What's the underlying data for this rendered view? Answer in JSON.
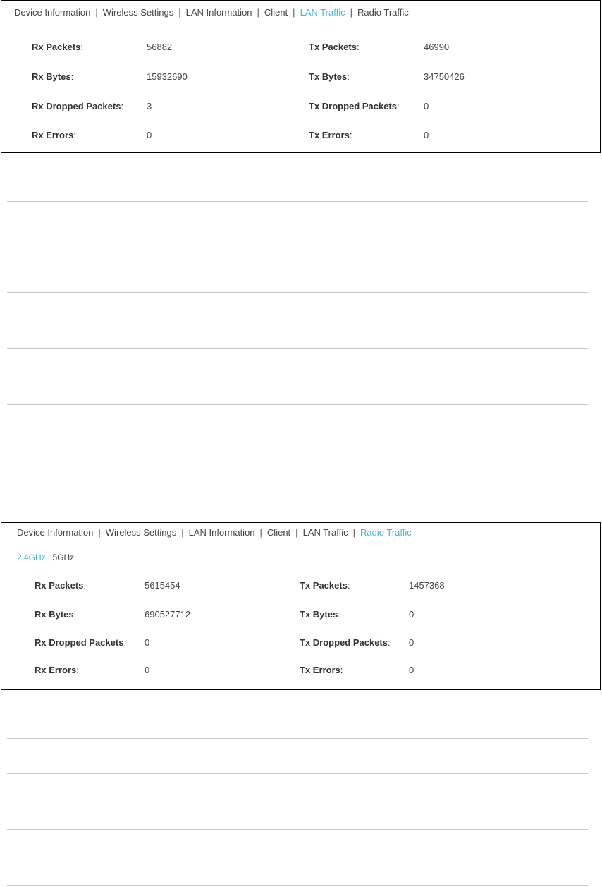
{
  "lan_traffic_panel": {
    "tabs": [
      "Device Information",
      "Wireless Settings",
      "LAN Information",
      "Client",
      "LAN Traffic",
      "Radio Traffic"
    ],
    "active_tab": "LAN Traffic",
    "separator": "|",
    "rows": [
      {
        "rx_label": "Rx Packets",
        "rx_value": "56882",
        "tx_label": "Tx Packets",
        "tx_value": "46990"
      },
      {
        "rx_label": "Rx Bytes",
        "rx_value": "15932690",
        "tx_label": "Tx Bytes",
        "tx_value": "34750426"
      },
      {
        "rx_label": "Rx Dropped Packets",
        "rx_value": "3",
        "tx_label": "Tx Dropped Packets",
        "tx_value": "0"
      },
      {
        "rx_label": "Rx Errors",
        "rx_value": "0",
        "tx_label": "Tx Errors",
        "tx_value": "0"
      }
    ]
  },
  "radio_traffic_panel": {
    "tabs": [
      "Device Information",
      "Wireless Settings",
      "LAN Information",
      "Client",
      "LAN Traffic",
      "Radio Traffic"
    ],
    "active_tab": "Radio Traffic",
    "separator": "|",
    "bands": [
      "2.4GHz",
      "5GHz"
    ],
    "active_band": "2.4GHz",
    "rows": [
      {
        "rx_label": "Rx Packets",
        "rx_value": "5615454",
        "tx_label": "Tx Packets",
        "tx_value": "1457368"
      },
      {
        "rx_label": "Rx Bytes",
        "rx_value": "690527712",
        "tx_label": "Tx Bytes",
        "tx_value": "0"
      },
      {
        "rx_label": "Rx Dropped Packets",
        "rx_value": "0",
        "tx_label": "Tx Dropped Packets",
        "tx_value": "0"
      },
      {
        "rx_label": "Rx Errors",
        "rx_value": "0",
        "tx_label": "Tx Errors",
        "tx_value": "0"
      }
    ]
  },
  "colors": {
    "active_link": "#41b6d8",
    "text": "#333333",
    "divider": "#c8c8c8",
    "panel_border": "#000000"
  }
}
